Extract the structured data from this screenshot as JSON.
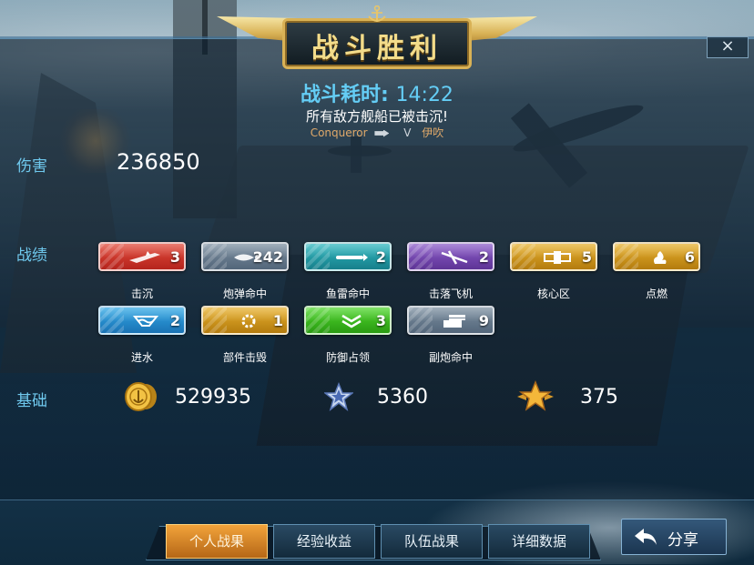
{
  "banner": {
    "title": "战斗胜利"
  },
  "close": {
    "label": "×",
    "icon": "close-icon"
  },
  "battle": {
    "time_label": "战斗耗时:",
    "time_value": "14:22",
    "result_message": "所有敌方舰船已被击沉!",
    "player": "Conqueror",
    "vs": "V",
    "opponent": "伊吹"
  },
  "damage": {
    "label": "伤害",
    "value": "236850"
  },
  "record": {
    "label": "战绩",
    "items": [
      {
        "name": "击沉",
        "count": "3",
        "color": "#d43a2c",
        "icon": "sinking-ship-icon"
      },
      {
        "name": "炮弹命中",
        "count": "242",
        "color": "#6d8296",
        "icon": "shell-hit-icon"
      },
      {
        "name": "鱼雷命中",
        "count": "2",
        "color": "#22a3ad",
        "icon": "torpedo-icon"
      },
      {
        "name": "击落飞机",
        "count": "2",
        "color": "#7a4ab8",
        "icon": "downed-plane-icon"
      },
      {
        "name": "核心区",
        "count": "5",
        "color": "#d69b1e",
        "icon": "citadel-icon"
      },
      {
        "name": "点燃",
        "count": "6",
        "color": "#d69b1e",
        "icon": "fire-icon"
      },
      {
        "name": "进水",
        "count": "2",
        "color": "#2690d4",
        "icon": "flooding-icon"
      },
      {
        "name": "部件击毁",
        "count": "1",
        "color": "#d69b1e",
        "icon": "module-destroyed-icon"
      },
      {
        "name": "防御占领",
        "count": "3",
        "color": "#3fc21f",
        "icon": "defense-capture-icon"
      },
      {
        "name": "副炮命中",
        "count": "9",
        "color": "#6d8296",
        "icon": "secondary-gun-icon"
      }
    ]
  },
  "basic": {
    "label": "基础",
    "credits": {
      "value": "529935",
      "icon": "gold-coin-icon"
    },
    "experience": {
      "value": "5360",
      "icon": "blue-star-icon"
    },
    "rank_points": {
      "value": "375",
      "icon": "gold-star-icon"
    }
  },
  "tabs": [
    {
      "label": "个人战果",
      "active": true
    },
    {
      "label": "经验收益",
      "active": false
    },
    {
      "label": "队伍战果",
      "active": false
    },
    {
      "label": "详细数据",
      "active": false
    }
  ],
  "share": {
    "label": "分享",
    "icon": "share-arrow-icon"
  }
}
